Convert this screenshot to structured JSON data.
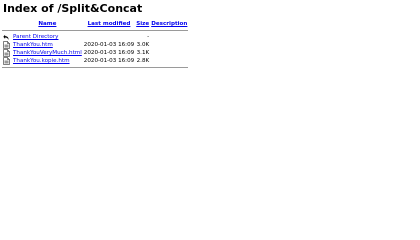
{
  "page": {
    "title": "Index of /Split&Concat"
  },
  "table": {
    "headers": {
      "name": "Name",
      "last_modified": "Last modified",
      "size": "Size",
      "description": "Description"
    },
    "parent": {
      "icon": "back-arrow-icon",
      "label": "Parent Directory",
      "size": "-"
    },
    "rows": [
      {
        "icon": "text-file-icon",
        "name": "ThankYou.htm",
        "modified": "2020-01-03 16:09",
        "size": "3.0K",
        "description": ""
      },
      {
        "icon": "text-file-icon",
        "name": "ThankYouVeryMuch.html",
        "modified": "2020-01-03 16:09",
        "size": "3.1K",
        "description": ""
      },
      {
        "icon": "text-file-icon",
        "name": "ThankYou.kopie.htm",
        "modified": "2020-01-03 16:09",
        "size": "2.8K",
        "description": ""
      }
    ]
  },
  "colors": {
    "link": "#0000ee",
    "rule": "#9a9a9a"
  }
}
